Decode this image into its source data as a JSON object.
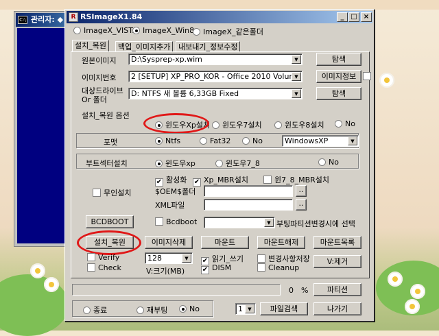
{
  "console_window": {
    "title": "관리자: ◆"
  },
  "app": {
    "title": "RSImageX1.84",
    "os_options": [
      {
        "label": "ImageX_VISTA",
        "selected": false
      },
      {
        "label": "ImageX_Win8",
        "selected": true
      },
      {
        "label": "ImageX_같은폴더",
        "selected": false
      }
    ],
    "tabs": [
      "설치_복원",
      "백업_이미지추가",
      "내보내기_정보수정"
    ],
    "source_image": {
      "label": "원본이미지",
      "value": "D:\\Sysprep-xp.wim",
      "button": "탐색"
    },
    "image_number": {
      "label": "이미지번호",
      "value": "2  [SETUP] XP_PRO_KOR - Office 2010 Volume Editio",
      "button": "이미지정보"
    },
    "target_drive": {
      "label": "대상드라이브\nOr 폴더",
      "value": "D:  NTFS  새 볼륨       6,33GB  Fixed",
      "button": "탐색"
    },
    "restore_options": {
      "title": "설치_복원 옵션",
      "os_radios": [
        {
          "label": "윈도우Xp설치",
          "selected": true
        },
        {
          "label": "윈도우7설치",
          "selected": false
        },
        {
          "label": "윈도우8설치",
          "selected": false
        },
        {
          "label": "No",
          "selected": false
        }
      ],
      "format": {
        "label": "포맷",
        "radios": [
          {
            "label": "Ntfs",
            "selected": true
          },
          {
            "label": "Fat32",
            "selected": false
          },
          {
            "label": "No",
            "selected": false
          }
        ],
        "volume_label": "WindowsXP"
      },
      "bootsector": {
        "label": "부트섹터설치",
        "radios": [
          {
            "label": "윈도우xp",
            "selected": true
          },
          {
            "label": "윈도우7_8",
            "selected": false
          },
          {
            "label": "No",
            "selected": false
          }
        ]
      },
      "checks_row": [
        {
          "label": "활성화",
          "checked": true
        },
        {
          "label": "Xp_MBR설치",
          "checked": true
        },
        {
          "label": "윈7_8_MBR설치",
          "checked": false
        }
      ],
      "unattended": {
        "label": "무인설치",
        "checked": false
      },
      "oem_folder": {
        "label": "$OEM$폴더",
        "value": "",
        "button": ".."
      },
      "xml_file": {
        "label": "XML파일",
        "value": "",
        "button": ".."
      },
      "bcdboot_button": "BCDBOOT",
      "bcdboot_check": {
        "label": "Bcdboot",
        "checked": false,
        "value": ""
      },
      "boot_partition_note": "부팅파티션변경시에 선택"
    },
    "action_buttons": [
      "설치_복원",
      "이미지삭제",
      "마운트",
      "마운트해제",
      "마운트목록"
    ],
    "verify": {
      "label": "Verify",
      "checked": false
    },
    "check": {
      "label": "Check",
      "checked": false
    },
    "size_value": "128",
    "size_label": "V:크기(MB)",
    "readwrite": {
      "label": "읽기_쓰기",
      "checked": true
    },
    "dism": {
      "label": "DISM",
      "checked": true
    },
    "save_changes": {
      "label": "변경사항저장",
      "checked": false
    },
    "cleanup": {
      "label": "Cleanup",
      "checked": false
    },
    "remove_v_button": "V:제거",
    "progress": {
      "value": 0,
      "percent_text": "0",
      "percent_sign": "%"
    },
    "partition_button": "파티션",
    "bottom_radios": [
      {
        "label": "종료",
        "selected": false
      },
      {
        "label": "재부팅",
        "selected": false
      },
      {
        "label": "No",
        "selected": true
      }
    ],
    "count_value": "1",
    "file_search_button": "파일검색",
    "exit_button": "나가기",
    "colors": {
      "titlebar_start": "#0a246a",
      "face": "#d4d0c8",
      "highlight_ellipse": "#e01818"
    }
  }
}
